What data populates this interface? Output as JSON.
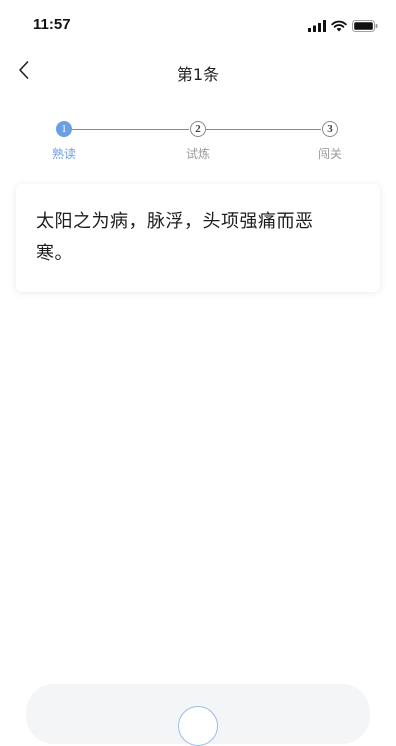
{
  "status_bar": {
    "time": "11:57",
    "icons": [
      "signal-icon",
      "wifi-icon",
      "battery-icon"
    ]
  },
  "nav": {
    "title": "第1条",
    "back_icon": "chevron-left-icon"
  },
  "stepper": {
    "steps": [
      {
        "number": "1",
        "label": "熟读",
        "active": true
      },
      {
        "number": "2",
        "label": "试炼",
        "active": false
      },
      {
        "number": "3",
        "label": "闯关",
        "active": false
      }
    ]
  },
  "card": {
    "text": "太阳之为病，脉浮，头项强痛而恶寒。"
  },
  "colors": {
    "accent": "#6a9fe6",
    "inactive_label": "#9a9a9a",
    "line": "#8a8a8a"
  }
}
